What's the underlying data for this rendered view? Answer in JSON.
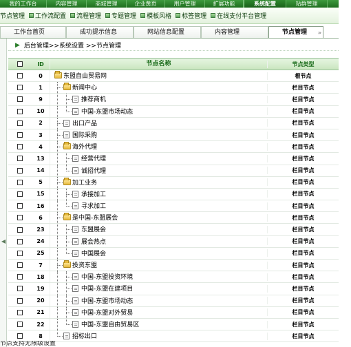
{
  "top_nav": {
    "items": [
      {
        "label": "我的工作台"
      },
      {
        "label": "内容管理"
      },
      {
        "label": "商城管理"
      },
      {
        "label": "企业黄页"
      },
      {
        "label": "用户管理"
      },
      {
        "label": "扩展功能"
      },
      {
        "label": "系统配置",
        "active": true
      },
      {
        "label": "站群管理"
      }
    ]
  },
  "sub_nav": {
    "items": [
      {
        "label": "节点管理"
      },
      {
        "label": "工作流配置"
      },
      {
        "label": "流程管理"
      },
      {
        "label": "专题管理"
      },
      {
        "label": "模板风格"
      },
      {
        "label": "标签管理"
      },
      {
        "label": "在线支付平台管理"
      }
    ]
  },
  "tabs": [
    {
      "label": "工作台首页"
    },
    {
      "label": "成功提示信息"
    },
    {
      "label": "网站信息配置"
    },
    {
      "label": "内容管理"
    },
    {
      "label": "节点管理",
      "active": true
    }
  ],
  "breadcrumb": "后台管理>>系统设置 >>节点管理",
  "table": {
    "col_id": "ID",
    "col_name": "节点名称",
    "col_type": "节点类型",
    "rows": [
      {
        "id": "0",
        "name": "东盟自由贸易网",
        "type": "根节点",
        "level": 0,
        "icon": "folder"
      },
      {
        "id": "1",
        "name": "新闻中心",
        "type": "栏目节点",
        "level": 1,
        "icon": "folder"
      },
      {
        "id": "9",
        "name": "推荐商机",
        "type": "栏目节点",
        "level": 2,
        "icon": "page"
      },
      {
        "id": "10",
        "name": "中国-东盟市场动态",
        "type": "栏目节点",
        "level": 2,
        "icon": "page"
      },
      {
        "id": "2",
        "name": "出口产品",
        "type": "栏目节点",
        "level": 1,
        "icon": "page"
      },
      {
        "id": "3",
        "name": "国际采购",
        "type": "栏目节点",
        "level": 1,
        "icon": "page"
      },
      {
        "id": "4",
        "name": "海外代理",
        "type": "栏目节点",
        "level": 1,
        "icon": "folder"
      },
      {
        "id": "13",
        "name": "经营代理",
        "type": "栏目节点",
        "level": 2,
        "icon": "page"
      },
      {
        "id": "14",
        "name": "诚招代理",
        "type": "栏目节点",
        "level": 2,
        "icon": "page"
      },
      {
        "id": "5",
        "name": "加工业务",
        "type": "栏目节点",
        "level": 1,
        "icon": "folder"
      },
      {
        "id": "15",
        "name": "承接加工",
        "type": "栏目节点",
        "level": 2,
        "icon": "page"
      },
      {
        "id": "16",
        "name": "寻求加工",
        "type": "栏目节点",
        "level": 2,
        "icon": "page"
      },
      {
        "id": "6",
        "name": "是中国-东盟展会",
        "type": "栏目节点",
        "level": 1,
        "icon": "folder"
      },
      {
        "id": "23",
        "name": "东盟展会",
        "type": "栏目节点",
        "level": 2,
        "icon": "page"
      },
      {
        "id": "24",
        "name": "展会热点",
        "type": "栏目节点",
        "level": 2,
        "icon": "page"
      },
      {
        "id": "25",
        "name": "中国展会",
        "type": "栏目节点",
        "level": 2,
        "icon": "page"
      },
      {
        "id": "7",
        "name": "投资东盟",
        "type": "栏目节点",
        "level": 1,
        "icon": "folder"
      },
      {
        "id": "18",
        "name": "中国-东盟投资环境",
        "type": "栏目节点",
        "level": 2,
        "icon": "page"
      },
      {
        "id": "19",
        "name": "中国-东盟在建项目",
        "type": "栏目节点",
        "level": 2,
        "icon": "page"
      },
      {
        "id": "20",
        "name": "中国-东盟市场动态",
        "type": "栏目节点",
        "level": 2,
        "icon": "page"
      },
      {
        "id": "21",
        "name": "中国-东盟对外贸易",
        "type": "栏目节点",
        "level": 2,
        "icon": "page"
      },
      {
        "id": "22",
        "name": "中国-东盟自由贸易区",
        "type": "栏目节点",
        "level": 2,
        "icon": "page"
      },
      {
        "id": "8",
        "name": "招标出口",
        "type": "栏目节点",
        "level": 1,
        "icon": "page"
      }
    ]
  },
  "footnote": "节点支持无限级设置"
}
